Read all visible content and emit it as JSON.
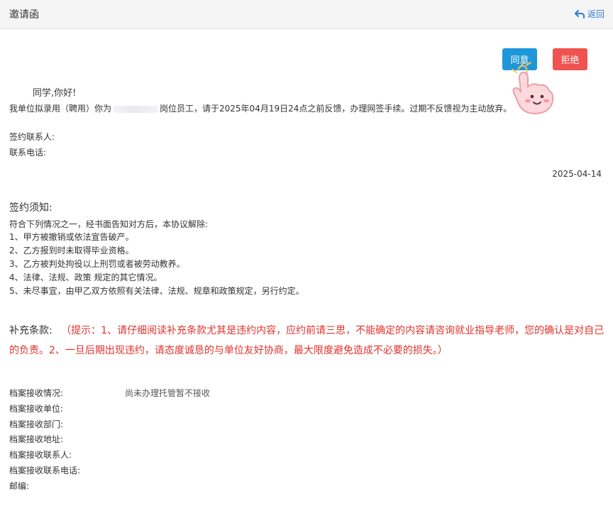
{
  "header": {
    "title": "邀请函",
    "back_label": "返回"
  },
  "actions": {
    "agree": "同意",
    "reject": "拒绝"
  },
  "letter": {
    "greeting": "同学,你好!",
    "body_prefix": "我单位拟录用（聘用）你为",
    "body_suffix": "岗位员工，请于2025年04月19日24点之前反馈，办理网签手续。过期不反馈视为主动放弃。",
    "contact_person_label": "签约联系人:",
    "contact_phone_label": "联系电话:",
    "date": "2025-04-14"
  },
  "notice": {
    "title": "签约须知:",
    "intro": "符合下列情况之一，经书面告知对方后，本协议解除:",
    "items": [
      "1、甲方被撤销或依法宣告破产。",
      "2、乙方报到时未取得毕业资格。",
      "3、乙方被判处拘役以上刑罚或者被劳动教养。",
      "4、法律、法规、政策 规定的其它情况。",
      "5、未尽事宜，由甲乙双方依照有关法律、法规、规章和政策规定，另行约定。"
    ]
  },
  "supplement": {
    "label": "补充条款:",
    "tip": "（提示：1、请仔细阅读补充条款尤其是违约内容，应约前请三思，不能确定的内容请咨询就业指导老师，您的确认是对自己的负责。2、一旦后期出现违约，请态度诚恳的与单位友好协商，最大限度避免造成不必要的损失。）"
  },
  "archive": {
    "status_label": "档案接收情况:",
    "status_value": "尚未办理托管暂不接收",
    "unit_label": "档案接收单位:",
    "dept_label": "档案接收部门:",
    "address_label": "档案接收地址:",
    "contact_label": "档案接收联系人:",
    "phone_label": "档案接收联系电话:",
    "zip_label": "邮编:"
  },
  "colors": {
    "agree": "#1e97d8",
    "reject": "#ef5350",
    "warning_text": "#e0332e",
    "link": "#2f7bd1"
  }
}
